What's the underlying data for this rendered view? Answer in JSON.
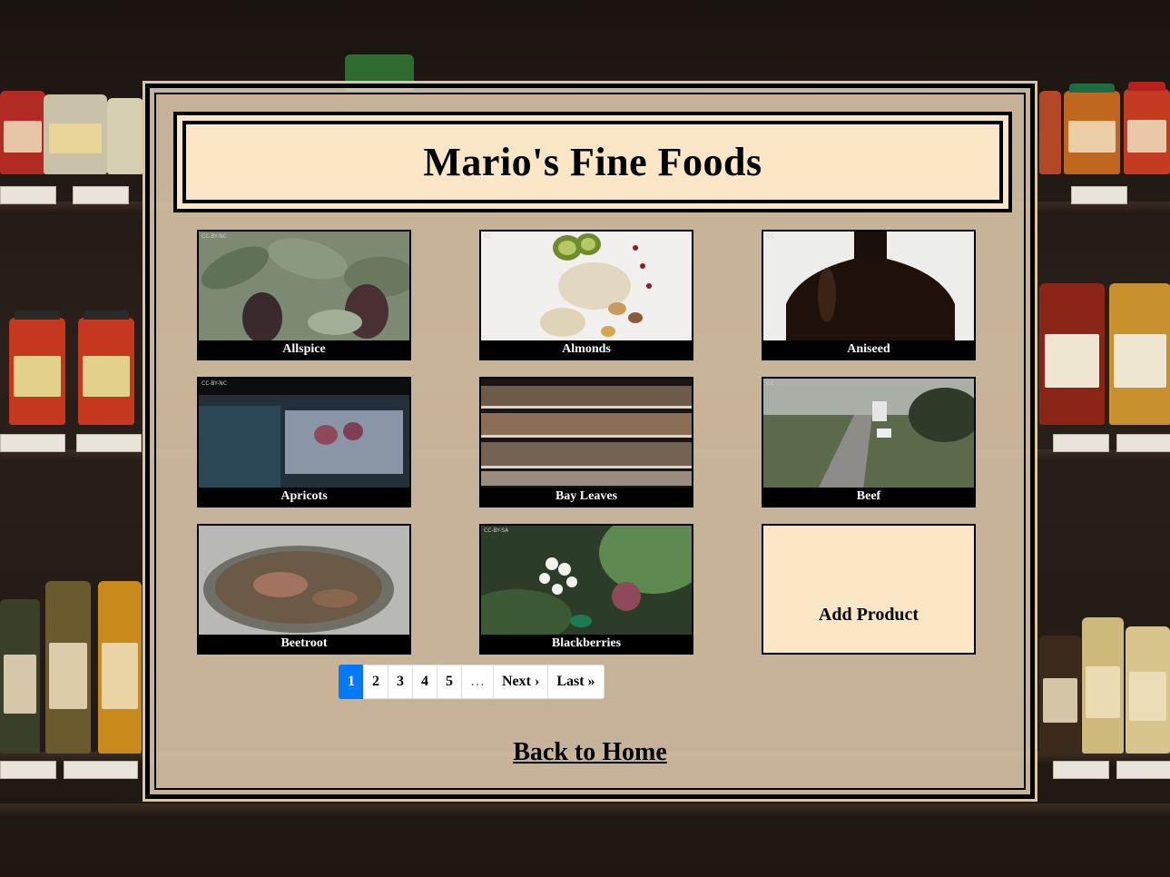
{
  "store": {
    "title": "Mario's Fine Foods"
  },
  "products": [
    {
      "name": "Allspice",
      "cc_label": "CC-BY-NC"
    },
    {
      "name": "Almonds",
      "cc_label": "CC"
    },
    {
      "name": "Aniseed",
      "cc_label": "CC"
    },
    {
      "name": "Apricots",
      "cc_label": "CC-BY-NC"
    },
    {
      "name": "Bay Leaves",
      "cc_label": ""
    },
    {
      "name": "Beef",
      "cc_label": "CC"
    },
    {
      "name": "Beetroot",
      "cc_label": ""
    },
    {
      "name": "Blackberries",
      "cc_label": "CC-BY-SA"
    }
  ],
  "add_product": {
    "label": "Add Product"
  },
  "pagination": {
    "pages": [
      "1",
      "2",
      "3",
      "4",
      "5"
    ],
    "current": "1",
    "ellipsis": "…",
    "next": "Next ›",
    "last": "Last »",
    "active_color": "#007bff"
  },
  "footer": {
    "back_link": "Back to Home"
  },
  "colors": {
    "panel_bg": "#f5debe",
    "card_caption_bg": "#000000",
    "border": "#000000"
  }
}
